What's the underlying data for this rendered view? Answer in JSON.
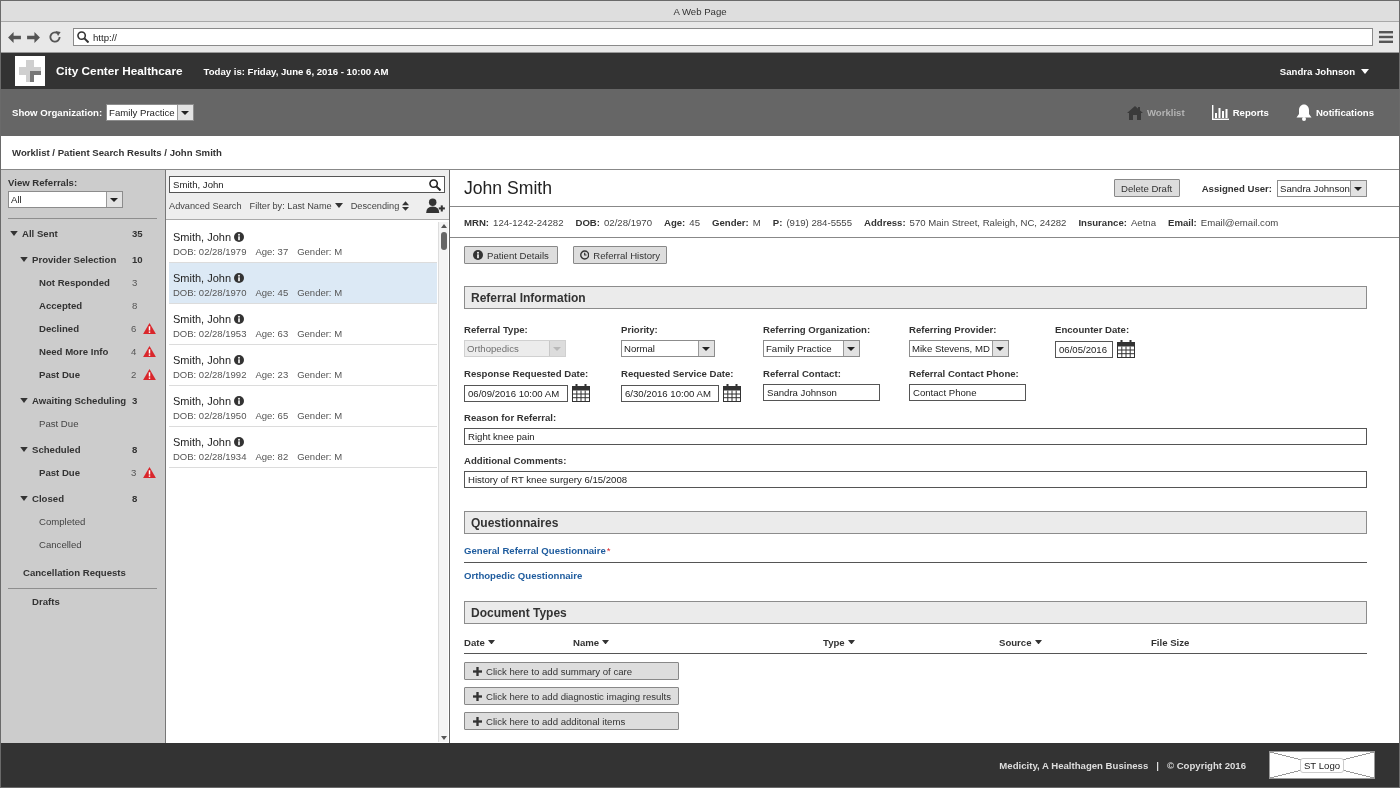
{
  "browser": {
    "title": "A Web Page",
    "url": "http://"
  },
  "app_header": {
    "name": "City Center Healthcare",
    "date": "Today is: Friday, June 6, 2016 - 10:00 AM",
    "user": "Sandra Johnson"
  },
  "org_bar": {
    "label": "Show Organization:",
    "organization": "Family Practice",
    "nav": [
      {
        "label": "Worklist",
        "kind": "home",
        "disabled": true
      },
      {
        "label": "Reports",
        "kind": "reports",
        "disabled": false
      },
      {
        "label": "Notifications",
        "kind": "notifications",
        "disabled": false
      }
    ]
  },
  "breadcrumb": "Worklist / Patient Search Results / John Smith",
  "sidebar": {
    "label": "View Referrals:",
    "filter": "All",
    "tree": [
      {
        "label": "All Sent",
        "count": "35",
        "expanded": true,
        "children": [
          {
            "label": "Provider Selection",
            "count": "10",
            "expanded": true,
            "children": [
              {
                "label": "Not Responded",
                "count": "3",
                "alert": false
              },
              {
                "label": "Accepted",
                "count": "8",
                "alert": false
              },
              {
                "label": "Declined",
                "count": "6",
                "alert": true
              },
              {
                "label": "Need More Info",
                "count": "4",
                "alert": true
              },
              {
                "label": "Past Due",
                "count": "2",
                "alert": true
              }
            ]
          },
          {
            "label": "Awaiting Scheduling",
            "count": "3",
            "expanded": true,
            "children": [
              {
                "label": "Past Due",
                "alert": false
              }
            ]
          },
          {
            "label": "Scheduled",
            "count": "8",
            "expanded": true,
            "children": [
              {
                "label": "Past Due",
                "count": "3",
                "alert": true
              }
            ]
          },
          {
            "label": "Closed",
            "count": "8",
            "expanded": true,
            "children": [
              {
                "label": "Completed",
                "alert": false
              },
              {
                "label": "Cancelled",
                "alert": false
              }
            ]
          }
        ]
      }
    ],
    "links": [
      "Cancellation Requests",
      "Drafts"
    ]
  },
  "patient_list": {
    "search": {
      "value": "Smith, John"
    },
    "advanced_search": "Advanced Search",
    "filter": "Filter by: Last Name",
    "sort": "Descending",
    "rows": [
      {
        "name": "Smith, John",
        "dob": "DOB: 02/28/1979",
        "age": "Age: 37",
        "gender": "Gender: M",
        "selected": false
      },
      {
        "name": "Smith, John",
        "dob": "DOB: 02/28/1970",
        "age": "Age: 45",
        "gender": "Gender: M",
        "selected": true
      },
      {
        "name": "Smith, John",
        "dob": "DOB: 02/28/1953",
        "age": "Age: 63",
        "gender": "Gender: M",
        "selected": false
      },
      {
        "name": "Smith, John",
        "dob": "DOB: 02/28/1992",
        "age": "Age: 23",
        "gender": "Gender: M",
        "selected": false
      },
      {
        "name": "Smith, John",
        "dob": "DOB: 02/28/1950",
        "age": "Age: 65",
        "gender": "Gender: M",
        "selected": false
      },
      {
        "name": "Smith, John",
        "dob": "DOB: 02/28/1934",
        "age": "Age: 82",
        "gender": "Gender: M",
        "selected": false
      }
    ]
  },
  "patient": {
    "name": "John Smith",
    "delete_button": "Delete Draft",
    "assigned_user": {
      "label": "Assigned User:",
      "value": "Sandra Johnson"
    },
    "demographics": [
      {
        "label": "MRN:",
        "value": "124-1242-24282"
      },
      {
        "label": "DOB:",
        "value": "02/28/1970"
      },
      {
        "label": "Age:",
        "value": "45"
      },
      {
        "label": "Gender:",
        "value": "M"
      },
      {
        "label": "P:",
        "value": "(919) 284-5555"
      },
      {
        "label": "Address:",
        "value": "570 Main Street, Raleigh, NC, 24282"
      },
      {
        "label": "Insurance:",
        "value": "Aetna"
      },
      {
        "label": "Email:",
        "value": "Email@email.com"
      }
    ],
    "actions": [
      {
        "label": "Patient Details",
        "kind": "info"
      },
      {
        "label": "Referral History",
        "kind": "history"
      }
    ]
  },
  "referral_information": {
    "title": "Referral Information",
    "fields": [
      {
        "label": "Referral Type:",
        "kind": "select",
        "value": "Orthopedics",
        "disabled": true
      },
      {
        "label": "Priority:",
        "kind": "select",
        "value": "Normal",
        "disabled": false
      },
      {
        "label": "Referring Organization:",
        "kind": "select",
        "value": "Family Practice",
        "disabled": false
      },
      {
        "label": "Referring Provider:",
        "kind": "select",
        "value": "Mike Stevens, MD",
        "disabled": false
      },
      {
        "label": "Encounter Date:",
        "kind": "date",
        "value": "06/05/2016",
        "disabled": false
      },
      {
        "label": "Response Requested Date:",
        "kind": "date",
        "value": "06/09/2016 10:00 AM",
        "disabled": false
      },
      {
        "label": "Requested Service Date:",
        "kind": "date",
        "value": "6/30/2016 10:00 AM",
        "disabled": false
      },
      {
        "label": "Referral Contact:",
        "kind": "text",
        "value": "Sandra Johnson",
        "disabled": false
      },
      {
        "label": "Referral Contact Phone:",
        "kind": "text",
        "value": "Contact Phone",
        "disabled": false
      },
      {
        "label": "Reason for Referral:",
        "kind": "wide",
        "value": "Right knee pain",
        "disabled": false
      },
      {
        "label": "Additional Comments:",
        "kind": "wide",
        "value": "History of RT knee surgery 6/15/2008",
        "disabled": false
      }
    ]
  },
  "questionnaires": {
    "title": "Questionnaires",
    "items": [
      {
        "label": "General Referral Questionnaire",
        "required_mark": "*"
      },
      {
        "label": "Orthopedic Questionnaire"
      }
    ]
  },
  "documents": {
    "title": "Document Types",
    "columns": [
      {
        "label": "Date",
        "sortable": true
      },
      {
        "label": "Name",
        "sortable": true
      },
      {
        "label": "Type",
        "sortable": true
      },
      {
        "label": "Source",
        "sortable": true
      },
      {
        "label": "File Size",
        "sortable": false
      }
    ],
    "add_buttons": [
      "Click here to add summary of care",
      "Click here to add diagnostic imaging results",
      "Click here to add additonal items"
    ]
  },
  "footer": {
    "text": "Medicity, A Healthagen Business   |   © Copyright 2016",
    "logo": "ST Logo"
  }
}
